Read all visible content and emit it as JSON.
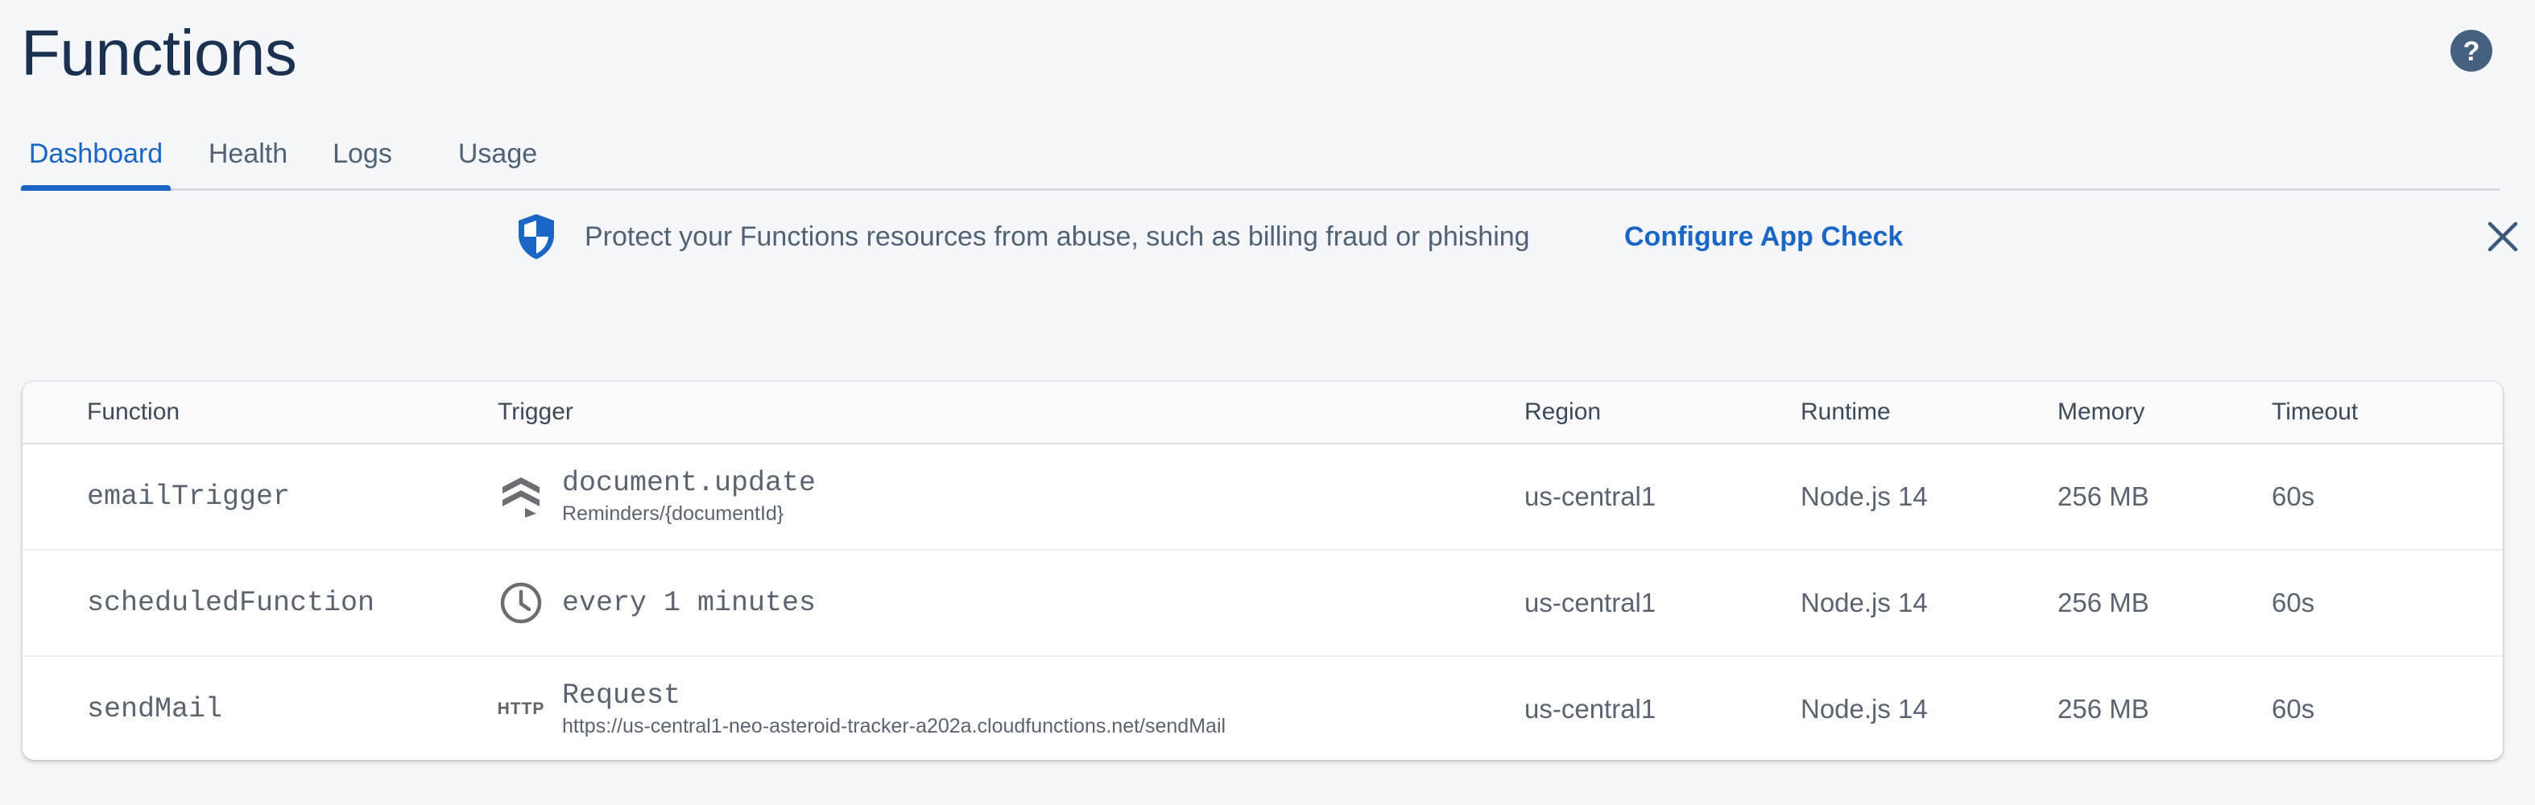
{
  "page": {
    "title": "Functions",
    "help_icon": "help-circle-icon"
  },
  "tabs": [
    {
      "label": "Dashboard",
      "active": true
    },
    {
      "label": "Health",
      "active": false
    },
    {
      "label": "Logs",
      "active": false
    },
    {
      "label": "Usage",
      "active": false
    }
  ],
  "banner": {
    "icon": "shield-icon",
    "text": "Protect your Functions resources from abuse, such as billing fraud or phishing",
    "link_label": "Configure App Check",
    "close_icon": "close-icon"
  },
  "table": {
    "columns": [
      "Function",
      "Trigger",
      "Region",
      "Runtime",
      "Memory",
      "Timeout"
    ],
    "rows": [
      {
        "function": "emailTrigger",
        "trigger_icon": "firestore-icon",
        "trigger": "document.update",
        "trigger_detail": "Reminders/{documentId}",
        "region": "us-central1",
        "runtime": "Node.js 14",
        "memory": "256 MB",
        "timeout": "60s"
      },
      {
        "function": "scheduledFunction",
        "trigger_icon": "clock-icon",
        "trigger": "every 1 minutes",
        "trigger_detail": "",
        "region": "us-central1",
        "runtime": "Node.js 14",
        "memory": "256 MB",
        "timeout": "60s"
      },
      {
        "function": "sendMail",
        "trigger_icon": "http-icon",
        "trigger_icon_label": "HTTP",
        "trigger": "Request",
        "trigger_detail": "https://us-central1-neo-asteroid-tracker-a202a.cloudfunctions.net/sendMail",
        "region": "us-central1",
        "runtime": "Node.js 14",
        "memory": "256 MB",
        "timeout": "60s"
      }
    ]
  },
  "colors": {
    "accent": "#1a66c4",
    "title": "#1a3150",
    "background": "#f5f6f9",
    "help_icon": "#44617f"
  }
}
